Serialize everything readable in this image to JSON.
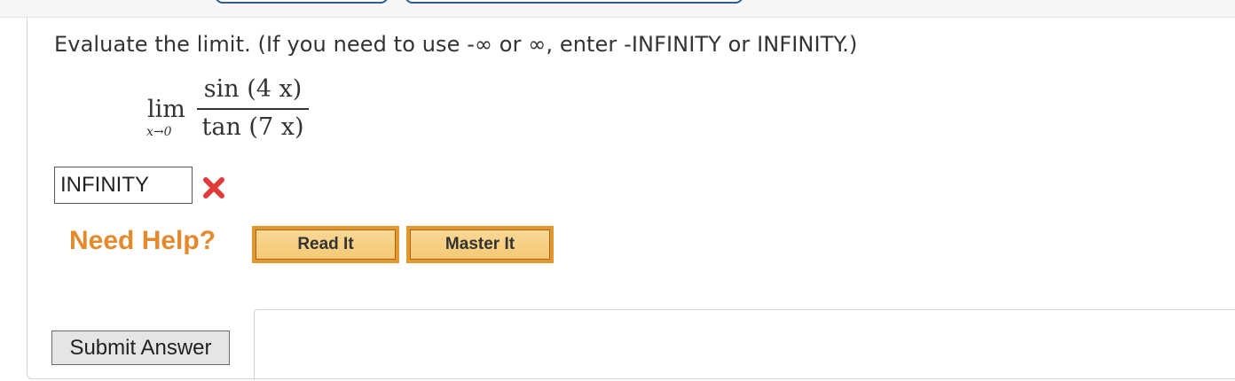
{
  "question": {
    "prompt": "Evaluate the limit. (If you need to use -∞ or ∞, enter -INFINITY or INFINITY.)",
    "expression": {
      "operator": "lim",
      "subscript": "x→0",
      "numerator": "sin (4 x)",
      "denominator": "tan (7 x)"
    }
  },
  "answer": {
    "value": "INFINITY",
    "status": "incorrect",
    "status_icon": "red-x-icon",
    "status_color": "#e03a3a"
  },
  "help": {
    "label": "Need Help?",
    "label_color": "#e58a2c",
    "buttons": [
      {
        "label": "Read It"
      },
      {
        "label": "Master It"
      }
    ],
    "button_color": "#f5c874"
  },
  "submit": {
    "label": "Submit Answer"
  }
}
